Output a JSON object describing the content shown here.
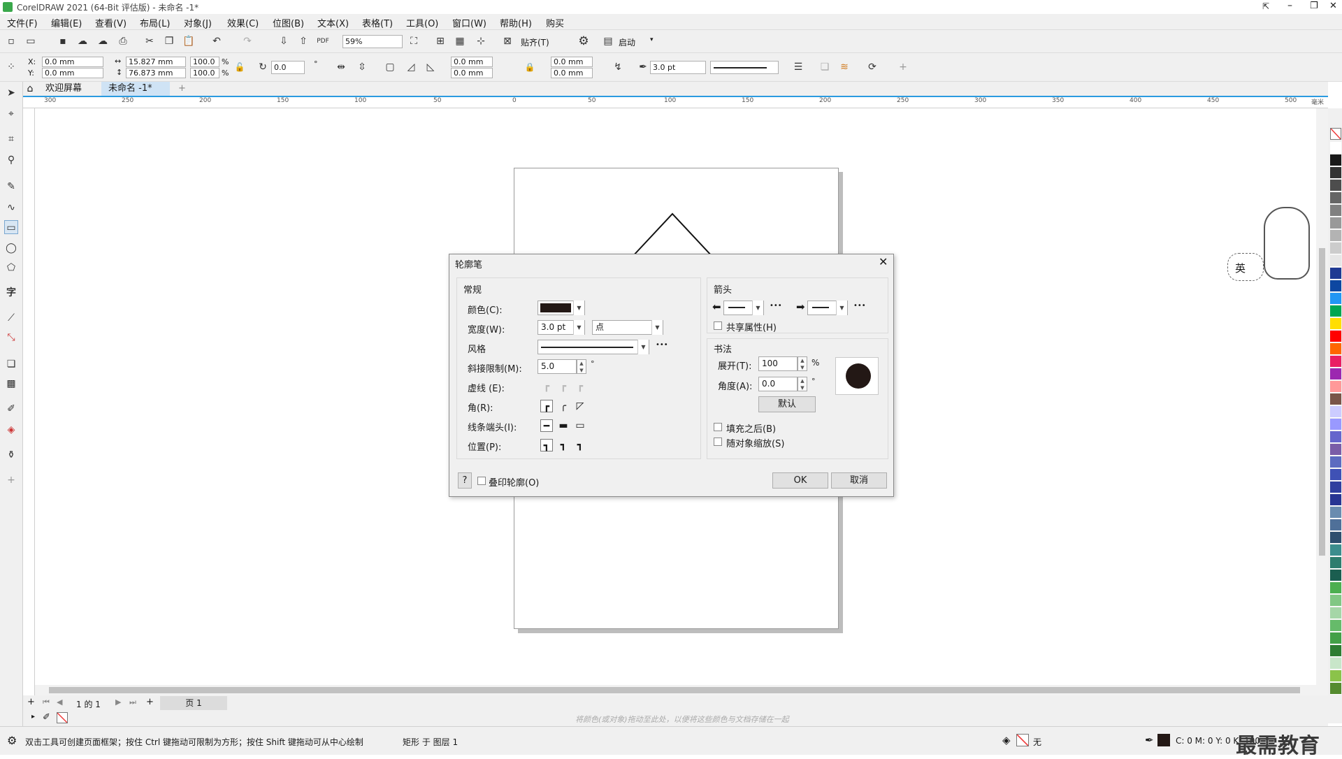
{
  "window": {
    "title": "CorelDRAW 2021 (64-Bit 评估版) - 未命名 -1*",
    "min": "–",
    "max": "❐",
    "close": "✕"
  },
  "menu": [
    "文件(F)",
    "编辑(E)",
    "查看(V)",
    "布局(L)",
    "对象(J)",
    "效果(C)",
    "位图(B)",
    "文本(X)",
    "表格(T)",
    "工具(O)",
    "窗口(W)",
    "帮助(H)",
    "购买"
  ],
  "toolbar": {
    "zoom": "59%",
    "snap": "贴齐(T)",
    "launch": "启动"
  },
  "props": {
    "x_label": "X:",
    "x": "0.0 mm",
    "y_label": "Y:",
    "y": "0.0 mm",
    "w": "15.827 mm",
    "h": "76.873 mm",
    "sx": "100.0",
    "sy": "100.0",
    "pct": "%",
    "angle": "0.0",
    "deg": "°",
    "c1": "0.0 mm",
    "c2": "0.0 mm",
    "c3": "0.0 mm",
    "c4": "0.0 mm",
    "outline_width": "3.0 pt"
  },
  "tabs": {
    "welcome": "欢迎屏幕",
    "doc": "未命名 -1*",
    "add": "+"
  },
  "ruler": {
    "unit": "毫米",
    "ticks": [
      "300",
      "250",
      "200",
      "150",
      "100",
      "50",
      "0",
      "50",
      "100",
      "150",
      "200",
      "250",
      "300",
      "350",
      "400",
      "450",
      "500"
    ]
  },
  "dialog": {
    "title": "轮廓笔",
    "general": "常规",
    "color_label": "颜色(C):",
    "color_value": "#231815",
    "width_label": "宽度(W):",
    "width_value": "3.0 pt",
    "unit_value": "点",
    "style_label": "风格",
    "miter_label": "斜接限制(M):",
    "miter_value": "5.0",
    "deg": "°",
    "dash_label": "虚线 (E):",
    "corner_label": "角(R):",
    "cap_label": "线条端头(I):",
    "pos_label": "位置(P):",
    "arrows": "箭头",
    "share_attr": "共享属性(H)",
    "calligraphy": "书法",
    "stretch_label": "展开(T):",
    "stretch_value": "100",
    "pct": "%",
    "angle_label": "角度(A):",
    "angle_value": "0.0",
    "default_btn": "默认",
    "fill_behind": "填充之后(B)",
    "scale_with": "随对象缩放(S)",
    "help": "?",
    "overprint": "叠印轮廓(O)",
    "ok": "OK",
    "cancel": "取消",
    "more": "•••"
  },
  "pagebar": {
    "page_of": "1 的 1",
    "page_tab": "页 1"
  },
  "color_dock_hint": "将颜色(或对象)拖动至此处，以便将这些颜色与文档存储在一起",
  "status": {
    "hint": "双击工具可创建页面框架；按住 Ctrl 键拖动可限制为方形；按住 Shift 键拖动可从中心绘制",
    "object": "矩形 于 图层 1",
    "fill": "无",
    "outline": "C: 0 M: 0 Y: 0 K: 100"
  },
  "ime": {
    "label": "英"
  },
  "watermark": "最需教育",
  "palette": [
    "#ffffff",
    "#1a1a1a",
    "#333333",
    "#4d4d4d",
    "#666666",
    "#808080",
    "#999999",
    "#b3b3b3",
    "#cccccc",
    "#e6e6e6",
    "#1f3a93",
    "#0d47a1",
    "#2196f3",
    "#00a651",
    "#ffde00",
    "#ff0000",
    "#ff6600",
    "#e91e63",
    "#9c27b0",
    "#ff9999",
    "#795548",
    "#ccccff",
    "#9999ff",
    "#6666cc",
    "#7a5da8",
    "#5c6bc0",
    "#3f51b5",
    "#303f9f",
    "#283593",
    "#6a8caf",
    "#4f7099",
    "#2e4e6e",
    "#3c8d8d",
    "#2e7d6e",
    "#1b5e50",
    "#4caf50",
    "#81c784",
    "#a5d6a7",
    "#66bb6a",
    "#43a047",
    "#2e7d32",
    "#c8e6c9",
    "#8bc34a",
    "#558b2f"
  ]
}
